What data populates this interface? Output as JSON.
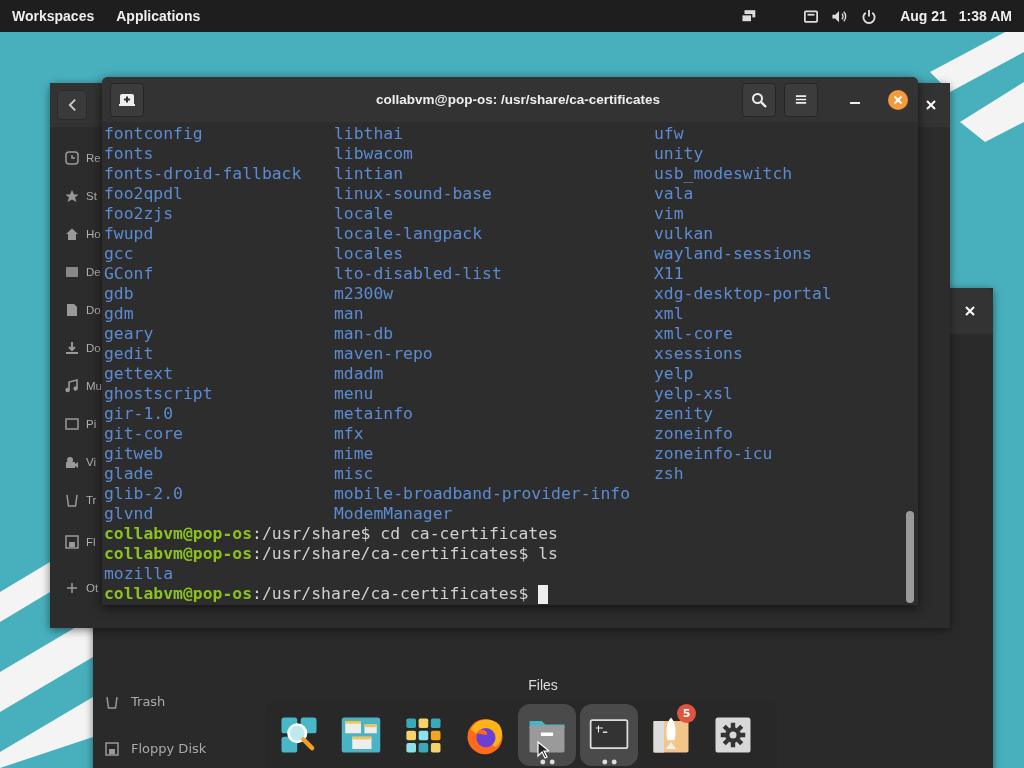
{
  "top_bar": {
    "workspaces": "Workspaces",
    "applications": "Applications",
    "date": "Aug 21",
    "time": "1:38 AM"
  },
  "files_window_back": {
    "sidebar": [
      {
        "label": "Re"
      },
      {
        "label": "St"
      },
      {
        "label": "Ho"
      },
      {
        "label": "De"
      },
      {
        "label": "Do"
      },
      {
        "label": "Do"
      },
      {
        "label": "Mu"
      },
      {
        "label": "Pi"
      },
      {
        "label": "Vi"
      },
      {
        "label": "Tr"
      },
      {
        "label": "Fl"
      },
      {
        "label": "Ot"
      }
    ]
  },
  "files_window_front": {
    "sidebar": [
      {
        "label": "Trash"
      },
      {
        "label": "Floppy Disk"
      }
    ]
  },
  "terminal": {
    "title": "collabvm@pop-os: /usr/share/ca-certificates",
    "columns": [
      [
        "fontconfig",
        "fonts",
        "fonts-droid-fallback",
        "foo2qpdl",
        "foo2zjs",
        "fwupd",
        "gcc",
        "GConf",
        "gdb",
        "gdm",
        "geary",
        "gedit",
        "gettext",
        "ghostscript",
        "gir-1.0",
        "git-core",
        "gitweb",
        "glade",
        "glib-2.0",
        "glvnd"
      ],
      [
        "libthai",
        "libwacom",
        "lintian",
        "linux-sound-base",
        "locale",
        "locale-langpack",
        "locales",
        "lto-disabled-list",
        "m2300w",
        "man",
        "man-db",
        "maven-repo",
        "mdadm",
        "menu",
        "metainfo",
        "mfx",
        "mime",
        "misc",
        "mobile-broadband-provider-info",
        "ModemManager"
      ],
      [
        "ufw",
        "unity",
        "usb_modeswitch",
        "vala",
        "vim",
        "vulkan",
        "wayland-sessions",
        "X11",
        "xdg-desktop-portal",
        "xml",
        "xml-core",
        "xsessions",
        "yelp",
        "yelp-xsl",
        "zenity",
        "zoneinfo",
        "zoneinfo-icu",
        "zsh"
      ]
    ],
    "lines": [
      {
        "kind": "prompt",
        "user": "collabvm@pop-os",
        "path": ":/usr/share",
        "command": "$ cd ca-certificates"
      },
      {
        "kind": "prompt",
        "user": "collabvm@pop-os",
        "path": ":/usr/share/ca-certificates",
        "command": "$ ls"
      },
      {
        "kind": "dir",
        "text": "mozilla"
      },
      {
        "kind": "prompt",
        "user": "collabvm@pop-os",
        "path": ":/usr/share/ca-certificates",
        "command": "$",
        "cursor": true
      }
    ]
  },
  "dock": {
    "tooltip": "Files",
    "items": [
      {
        "running": false
      },
      {
        "running": false
      },
      {
        "running": false
      },
      {
        "running": false
      },
      {
        "running": true
      },
      {
        "running": true
      },
      {
        "running": false,
        "badge": "5"
      },
      {
        "running": false
      }
    ]
  }
}
